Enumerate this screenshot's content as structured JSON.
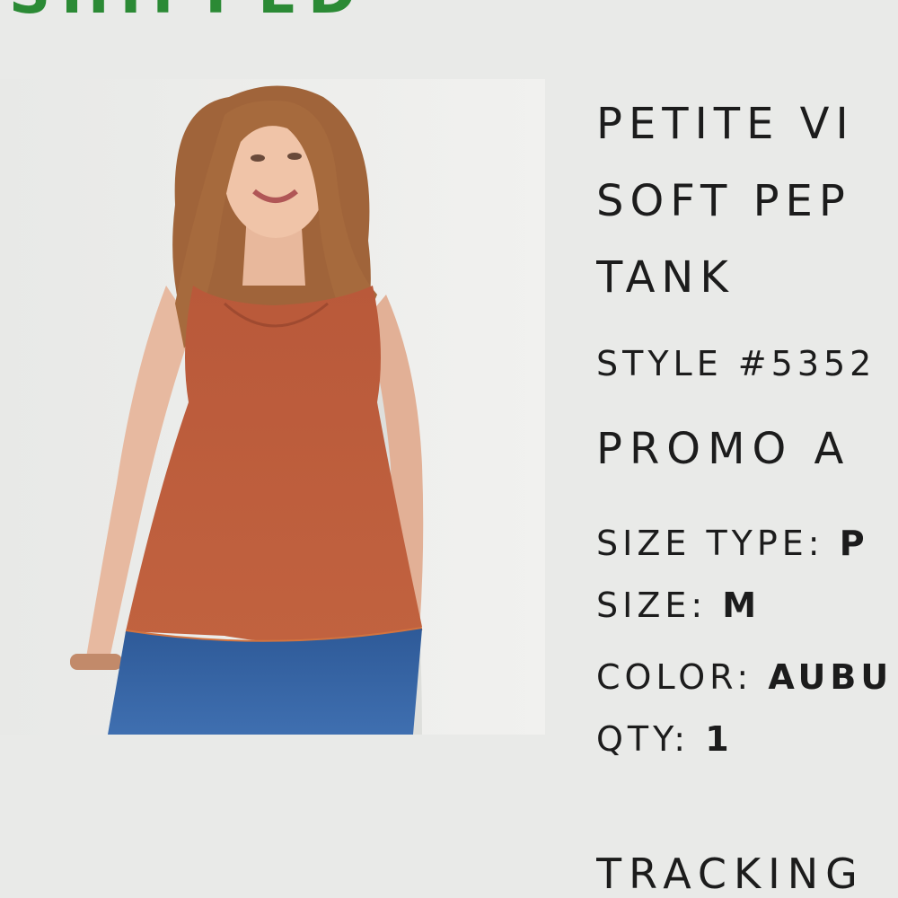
{
  "order": {
    "status_label": "SHIPPED"
  },
  "product": {
    "image_alt": "Woman wearing auburn peplum tank top with jeans",
    "name_lines": [
      "PETITE VI",
      "SOFT PEP",
      "TANK"
    ],
    "style_number": "STYLE #5352",
    "promo": "PROMO A",
    "size_type_label": "SIZE TYPE:",
    "size_type_value": "P",
    "size_label": "SIZE:",
    "size_value": "M",
    "color_label": "COLOR:",
    "color_value": "AUBU",
    "qty_label": "QTY:",
    "qty_value": "1"
  },
  "tracking": {
    "label": "TRACKING"
  },
  "colors": {
    "status_green": "#2b8a35",
    "background": "#e9eae8",
    "text": "#1c1c1c",
    "top_color": "#b85a3a"
  }
}
